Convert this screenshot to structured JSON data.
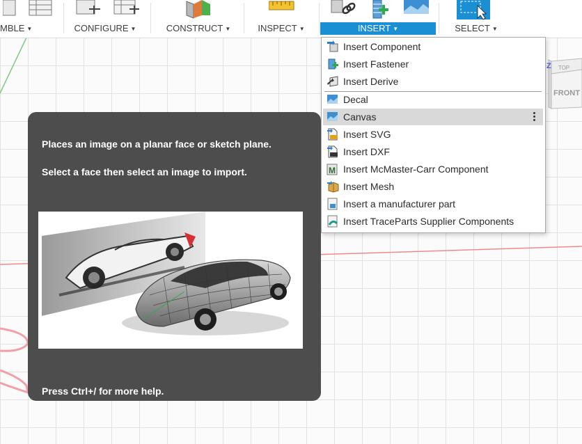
{
  "toolbar": {
    "groups": [
      {
        "id": "assemble",
        "label": "MBLE",
        "active": false
      },
      {
        "id": "configure",
        "label": "CONFIGURE",
        "active": false
      },
      {
        "id": "construct",
        "label": "CONSTRUCT",
        "active": false
      },
      {
        "id": "inspect",
        "label": "INSPECT",
        "active": false
      },
      {
        "id": "insert",
        "label": "INSERT",
        "active": true
      },
      {
        "id": "select",
        "label": "SELECT",
        "active": false
      }
    ],
    "accent_color": "#1a8fd3"
  },
  "insert_menu": {
    "items": [
      {
        "label": "Insert Component",
        "icon": "insert-component-icon"
      },
      {
        "label": "Insert Fastener",
        "icon": "insert-fastener-icon"
      },
      {
        "label": "Insert Derive",
        "icon": "insert-derive-icon"
      },
      {
        "label": "Decal",
        "icon": "decal-icon"
      },
      {
        "label": "Canvas",
        "icon": "canvas-icon",
        "highlighted": true
      },
      {
        "label": "Insert SVG",
        "icon": "svg-file-icon"
      },
      {
        "label": "Insert DXF",
        "icon": "dxf-file-icon"
      },
      {
        "label": "Insert McMaster-Carr Component",
        "icon": "mcmaster-icon"
      },
      {
        "label": "Insert Mesh",
        "icon": "mesh-icon"
      },
      {
        "label": "Insert a manufacturer part",
        "icon": "manufacturer-part-icon"
      },
      {
        "label": "Insert TraceParts Supplier Components",
        "icon": "traceparts-icon"
      }
    ]
  },
  "tooltip": {
    "line1": "Places an image on a planar face or sketch plane.",
    "line2": "Select a face then select an image to import.",
    "help": "Press Ctrl+/ for more help."
  },
  "view_cube": {
    "top_label": "TOP",
    "front_label": "FRONT",
    "axis_label": "Z"
  }
}
